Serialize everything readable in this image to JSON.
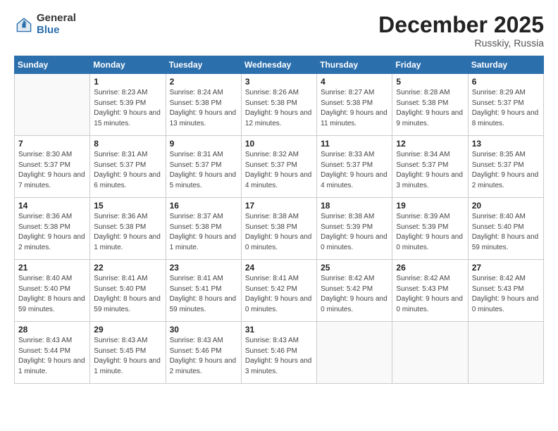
{
  "logo": {
    "general": "General",
    "blue": "Blue"
  },
  "header": {
    "month": "December 2025",
    "location": "Russkiy, Russia"
  },
  "weekdays": [
    "Sunday",
    "Monday",
    "Tuesday",
    "Wednesday",
    "Thursday",
    "Friday",
    "Saturday"
  ],
  "weeks": [
    [
      {
        "day": "",
        "empty": true
      },
      {
        "day": "1",
        "sunrise": "8:23 AM",
        "sunset": "5:39 PM",
        "daylight": "9 hours and 15 minutes."
      },
      {
        "day": "2",
        "sunrise": "8:24 AM",
        "sunset": "5:38 PM",
        "daylight": "9 hours and 13 minutes."
      },
      {
        "day": "3",
        "sunrise": "8:26 AM",
        "sunset": "5:38 PM",
        "daylight": "9 hours and 12 minutes."
      },
      {
        "day": "4",
        "sunrise": "8:27 AM",
        "sunset": "5:38 PM",
        "daylight": "9 hours and 11 minutes."
      },
      {
        "day": "5",
        "sunrise": "8:28 AM",
        "sunset": "5:38 PM",
        "daylight": "9 hours and 9 minutes."
      },
      {
        "day": "6",
        "sunrise": "8:29 AM",
        "sunset": "5:37 PM",
        "daylight": "9 hours and 8 minutes."
      }
    ],
    [
      {
        "day": "7",
        "sunrise": "8:30 AM",
        "sunset": "5:37 PM",
        "daylight": "9 hours and 7 minutes."
      },
      {
        "day": "8",
        "sunrise": "8:31 AM",
        "sunset": "5:37 PM",
        "daylight": "9 hours and 6 minutes."
      },
      {
        "day": "9",
        "sunrise": "8:31 AM",
        "sunset": "5:37 PM",
        "daylight": "9 hours and 5 minutes."
      },
      {
        "day": "10",
        "sunrise": "8:32 AM",
        "sunset": "5:37 PM",
        "daylight": "9 hours and 4 minutes."
      },
      {
        "day": "11",
        "sunrise": "8:33 AM",
        "sunset": "5:37 PM",
        "daylight": "9 hours and 4 minutes."
      },
      {
        "day": "12",
        "sunrise": "8:34 AM",
        "sunset": "5:37 PM",
        "daylight": "9 hours and 3 minutes."
      },
      {
        "day": "13",
        "sunrise": "8:35 AM",
        "sunset": "5:37 PM",
        "daylight": "9 hours and 2 minutes."
      }
    ],
    [
      {
        "day": "14",
        "sunrise": "8:36 AM",
        "sunset": "5:38 PM",
        "daylight": "9 hours and 2 minutes."
      },
      {
        "day": "15",
        "sunrise": "8:36 AM",
        "sunset": "5:38 PM",
        "daylight": "9 hours and 1 minute."
      },
      {
        "day": "16",
        "sunrise": "8:37 AM",
        "sunset": "5:38 PM",
        "daylight": "9 hours and 1 minute."
      },
      {
        "day": "17",
        "sunrise": "8:38 AM",
        "sunset": "5:38 PM",
        "daylight": "9 hours and 0 minutes."
      },
      {
        "day": "18",
        "sunrise": "8:38 AM",
        "sunset": "5:39 PM",
        "daylight": "9 hours and 0 minutes."
      },
      {
        "day": "19",
        "sunrise": "8:39 AM",
        "sunset": "5:39 PM",
        "daylight": "9 hours and 0 minutes."
      },
      {
        "day": "20",
        "sunrise": "8:40 AM",
        "sunset": "5:40 PM",
        "daylight": "8 hours and 59 minutes."
      }
    ],
    [
      {
        "day": "21",
        "sunrise": "8:40 AM",
        "sunset": "5:40 PM",
        "daylight": "8 hours and 59 minutes."
      },
      {
        "day": "22",
        "sunrise": "8:41 AM",
        "sunset": "5:40 PM",
        "daylight": "8 hours and 59 minutes."
      },
      {
        "day": "23",
        "sunrise": "8:41 AM",
        "sunset": "5:41 PM",
        "daylight": "8 hours and 59 minutes."
      },
      {
        "day": "24",
        "sunrise": "8:41 AM",
        "sunset": "5:42 PM",
        "daylight": "9 hours and 0 minutes."
      },
      {
        "day": "25",
        "sunrise": "8:42 AM",
        "sunset": "5:42 PM",
        "daylight": "9 hours and 0 minutes."
      },
      {
        "day": "26",
        "sunrise": "8:42 AM",
        "sunset": "5:43 PM",
        "daylight": "9 hours and 0 minutes."
      },
      {
        "day": "27",
        "sunrise": "8:42 AM",
        "sunset": "5:43 PM",
        "daylight": "9 hours and 0 minutes."
      }
    ],
    [
      {
        "day": "28",
        "sunrise": "8:43 AM",
        "sunset": "5:44 PM",
        "daylight": "9 hours and 1 minute."
      },
      {
        "day": "29",
        "sunrise": "8:43 AM",
        "sunset": "5:45 PM",
        "daylight": "9 hours and 1 minute."
      },
      {
        "day": "30",
        "sunrise": "8:43 AM",
        "sunset": "5:46 PM",
        "daylight": "9 hours and 2 minutes."
      },
      {
        "day": "31",
        "sunrise": "8:43 AM",
        "sunset": "5:46 PM",
        "daylight": "9 hours and 3 minutes."
      },
      {
        "day": "",
        "empty": true
      },
      {
        "day": "",
        "empty": true
      },
      {
        "day": "",
        "empty": true
      }
    ]
  ],
  "labels": {
    "sunrise": "Sunrise:",
    "sunset": "Sunset:",
    "daylight": "Daylight:"
  }
}
